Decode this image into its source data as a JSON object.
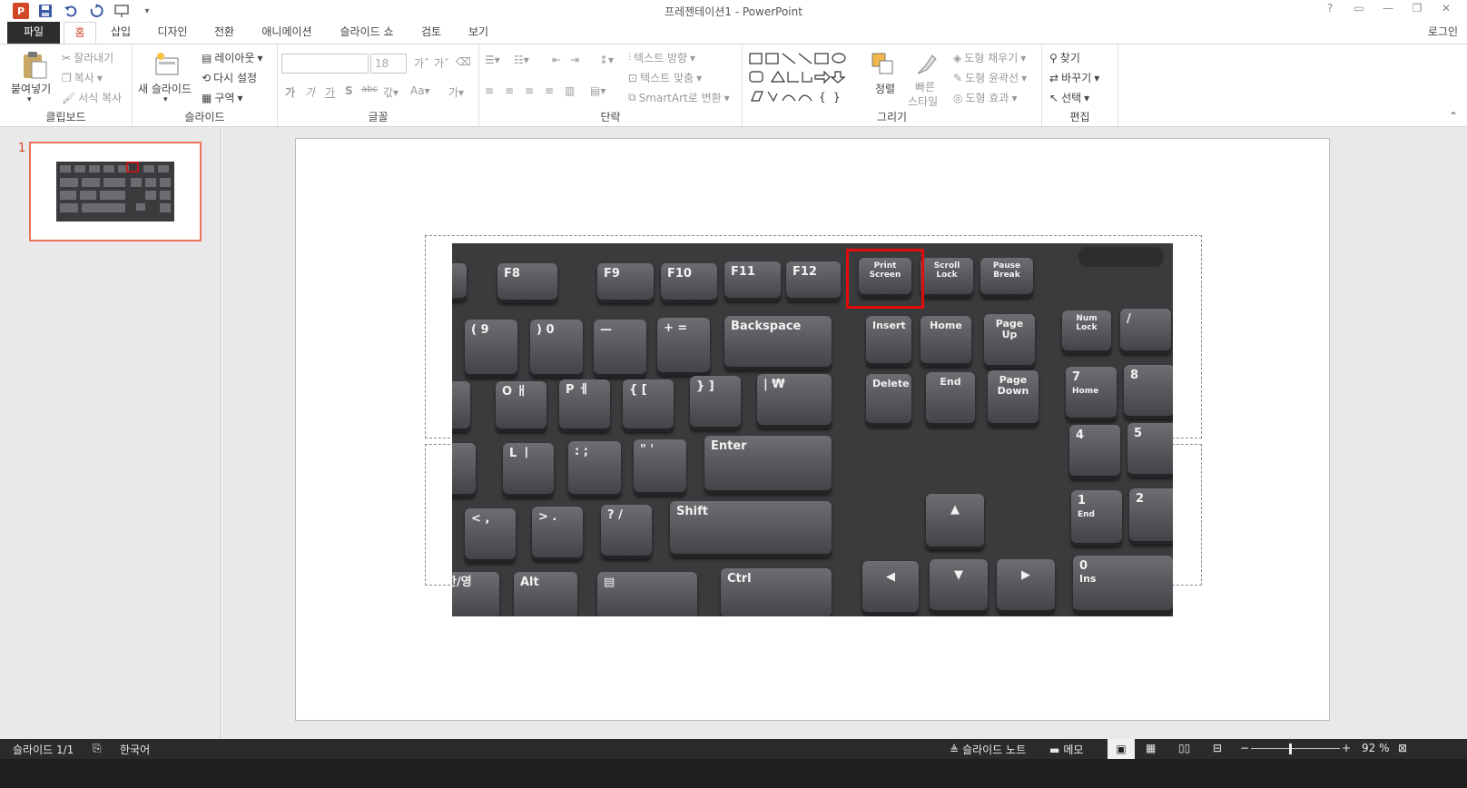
{
  "window": {
    "title": "프레젠테이션1 - PowerPoint",
    "login": "로그인"
  },
  "qat_icons": [
    "powerpoint-logo-icon",
    "save-icon",
    "undo-icon",
    "redo-icon",
    "presentation-icon",
    "customize-icon"
  ],
  "tabs": [
    "파일",
    "홈",
    "삽입",
    "디자인",
    "전환",
    "애니메이션",
    "슬라이드 쇼",
    "검토",
    "보기"
  ],
  "ribbon": {
    "clipboard": {
      "label": "클립보드",
      "paste": "붙여넣기",
      "cut": "잘라내기",
      "copy": "복사",
      "format_painter": "서식 복사"
    },
    "slides": {
      "label": "슬라이드",
      "new_slide": "새 슬라이드",
      "layout": "레이아웃",
      "reset": "다시 설정",
      "section": "구역"
    },
    "font": {
      "label": "글꼴",
      "size": "18"
    },
    "paragraph": {
      "label": "단락",
      "text_direction": "텍스트 방향",
      "align_text": "텍스트 맞춤",
      "smartart": "SmartArt로 변환"
    },
    "drawing": {
      "label": "그리기",
      "arrange": "정렬",
      "quick_styles_1": "빠른",
      "quick_styles_2": "스타일",
      "shape_fill": "도형 채우기",
      "shape_outline": "도형 윤곽선",
      "shape_effects": "도형 효과"
    },
    "editing": {
      "label": "편집",
      "find": "찾기",
      "replace": "바꾸기",
      "select": "선택"
    }
  },
  "thumbnail": {
    "number": "1"
  },
  "keyboard": {
    "f8": "F8",
    "f9": "F9",
    "f10": "F10",
    "f11": "F11",
    "f12": "F12",
    "print_screen": "Print Screen",
    "scroll_lock": "Scroll Lock",
    "pause_break": "Pause Break",
    "backspace": "Backspace",
    "insert": "Insert",
    "home": "Home",
    "page_up": "Page Up",
    "num_lock": "Num Lock",
    "slash": "/",
    "delete": "Delete",
    "end": "End",
    "page_down": "Page Down",
    "seven": "7",
    "home_sub": "Home",
    "eight": "8",
    "four": "4",
    "five": "5",
    "enter": "Enter",
    "shift": "Shift",
    "ctrl": "Ctrl",
    "alt": "Alt",
    "hanyoung": "한/영",
    "one": "1",
    "end_sub": "End",
    "two": "2",
    "zero": "0",
    "ins": "Ins",
    "paren_open": "( 9",
    "paren_close": ") 0",
    "minus": "—",
    "plus": "+ =",
    "o_key": "O ㅐ",
    "p_key": "P ㅔ",
    "brace_open": "{ [",
    "brace_close": "} ]",
    "pipe": "| ₩",
    "l_key": "L ㅣ",
    "colon": ": ;",
    "quote": "\" '",
    "lt": "< ,",
    "gt": "> .",
    "question": "? /"
  },
  "status": {
    "slide": "슬라이드 1/1",
    "language": "한국어",
    "notes": "슬라이드 노트",
    "comments": "메모",
    "zoom": "92 %"
  }
}
